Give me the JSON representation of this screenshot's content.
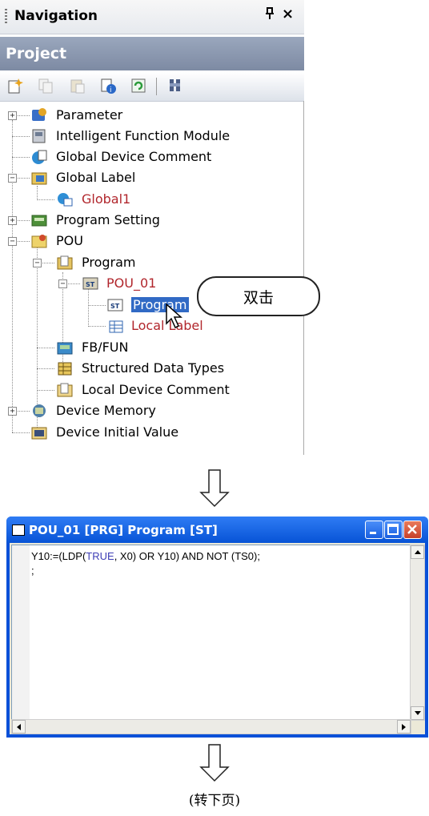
{
  "navigation": {
    "title": "Navigation",
    "pin_glyph": "ᵖ",
    "close_glyph": "×",
    "project_label": "Project",
    "toolbar_icons": [
      "new-data-icon",
      "copy-icon",
      "paste-icon",
      "property-icon",
      "refresh-icon",
      "find-icon"
    ],
    "tree": {
      "parameter": "Parameter",
      "intelligent_function_module": "Intelligent Function Module",
      "global_device_comment": "Global Device Comment",
      "global_label": "Global Label",
      "global1": "Global1",
      "program_setting": "Program Setting",
      "pou": "POU",
      "program": "Program",
      "pou_01": "POU_01",
      "program_item": "Program",
      "local_label": "Local Label",
      "fb_fun": "FB/FUN",
      "structured_data_types": "Structured Data Types",
      "local_device_comment": "Local Device Comment",
      "device_memory": "Device Memory",
      "device_initial_value": "Device Initial Value"
    },
    "expand_glyph": "+",
    "collapse_glyph": "−"
  },
  "callout": {
    "text": "双击"
  },
  "editor_window": {
    "title": "POU_01 [PRG] Program [ST]",
    "code_line_1_a": "Y10:=(LDP(",
    "code_line_1_kw": "TRUE",
    "code_line_1_b": ", X0) OR Y10) AND NOT (TS0);",
    "code_line_2": ";"
  },
  "footer": {
    "text": "(转下页)"
  },
  "colors": {
    "title_blue": "#0753d6",
    "selection": "#316ac5",
    "red_item": "#b1262c",
    "project_bar": "#8592aa"
  }
}
